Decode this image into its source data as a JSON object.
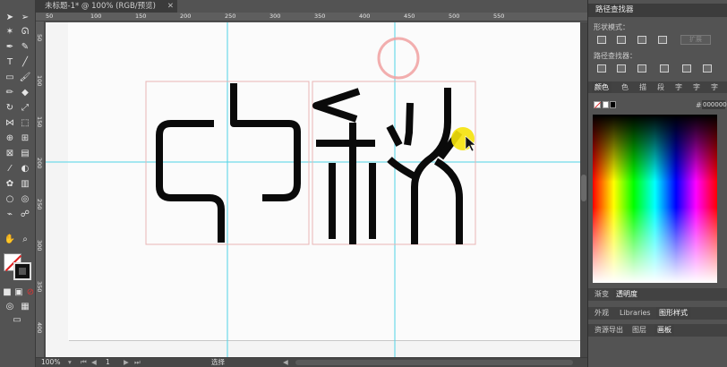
{
  "document_tab": {
    "title": "未标题-1* @ 100% (RGB/预览)",
    "close": "✕"
  },
  "ruler": {
    "top_ticks": [
      "50",
      "100",
      "150",
      "200",
      "250",
      "300",
      "350",
      "400",
      "450",
      "500",
      "550"
    ],
    "left_ticks": [
      "50",
      "100",
      "150",
      "200",
      "250",
      "300",
      "350",
      "400"
    ]
  },
  "status": {
    "zoom": "100%",
    "page": "1",
    "mode": "选择"
  },
  "pathfinder": {
    "title": "路径查找器",
    "shape_modes_label": "形状模式：",
    "pathfinders_label": "路径查找器：",
    "expand_label": "扩展"
  },
  "color_panel": {
    "tabs": [
      "颜色",
      "色",
      "描",
      "段",
      "字",
      "字",
      "字"
    ],
    "hex_label": "#",
    "hex_value": "000000"
  },
  "bottom_tabs_1": [
    "渐变",
    "透明度"
  ],
  "bottom_tabs_2": [
    "外观",
    "Libraries",
    "图形样式"
  ],
  "bottom_tabs_3": [
    "资源导出",
    "图层",
    "画板"
  ],
  "colors": {
    "canvas": "#fbfbfb",
    "guide": "#4fd3e6",
    "glyph": "#0a0a0a",
    "box_border": "#e8b4b4",
    "cursor_highlight": "#f5e20a",
    "click_ring": "#f0a0a0"
  },
  "icons": [
    "selection-icon",
    "direct-select-icon",
    "pen-icon",
    "type-icon",
    "line-icon",
    "brush-icon",
    "pencil-icon",
    "eraser-icon",
    "rotate-icon",
    "scale-icon",
    "width-icon",
    "free-transform-icon",
    "shape-builder-icon",
    "perspective-icon",
    "mesh-icon",
    "gradient-icon",
    "eyedropper-icon",
    "blend-icon",
    "symbol-icon",
    "graph-icon",
    "artboard-icon",
    "slice-icon",
    "hand-icon",
    "zoom-icon",
    "fill-stroke-icon",
    "swap-icon",
    "screen-mode-icon"
  ]
}
